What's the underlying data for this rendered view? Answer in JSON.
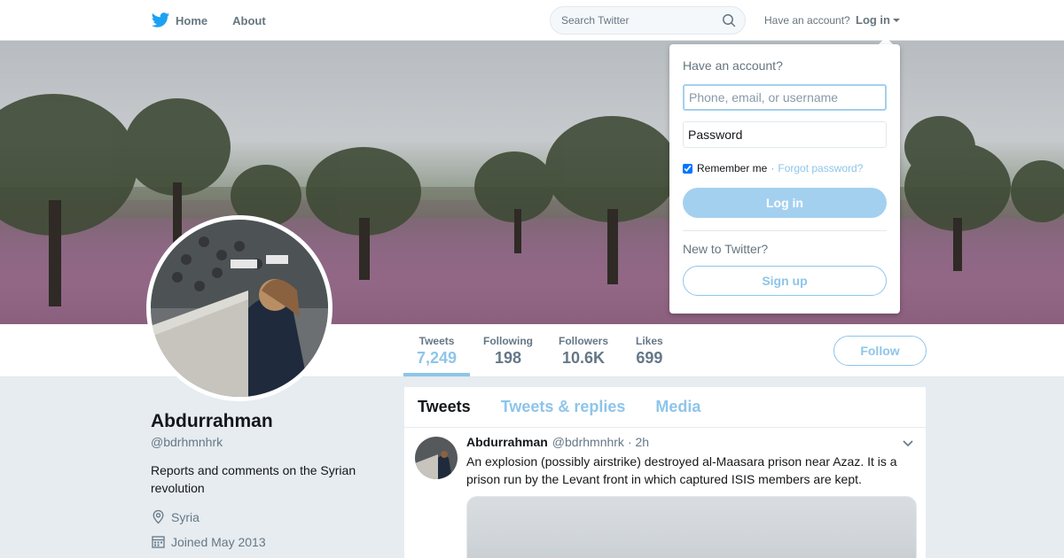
{
  "nav": {
    "home_label": "Home",
    "about_label": "About",
    "search_placeholder": "Search Twitter",
    "have_account": "Have an account?",
    "login_label": "Log in"
  },
  "profile": {
    "name": "Abdurrahman",
    "handle": "@bdrhmnhrk",
    "bio": "Reports and comments on the Syrian revolution",
    "location": "Syria",
    "joined": "Joined May 2013"
  },
  "stats": [
    {
      "label": "Tweets",
      "value": "7,249",
      "active": true
    },
    {
      "label": "Following",
      "value": "198"
    },
    {
      "label": "Followers",
      "value": "10.6K"
    },
    {
      "label": "Likes",
      "value": "699"
    }
  ],
  "follow_label": "Follow",
  "timeline": {
    "tabs": [
      "Tweets",
      "Tweets & replies",
      "Media"
    ],
    "tweet": {
      "name": "Abdurrahman",
      "handle": "@bdrhmnhrk",
      "time": "· 2h",
      "text": "An explosion (possibly airstrike) destroyed al-Maasara prison near Azaz. It is a prison run by the Levant front in which captured ISIS members are kept."
    }
  },
  "login_dropdown": {
    "title": "Have an account?",
    "username_placeholder": "Phone, email, or username",
    "password_placeholder": "Password",
    "remember_label": "Remember me",
    "remember_checked": true,
    "forgot_label": "Forgot password?",
    "login_button": "Log in",
    "new_label": "New to Twitter?",
    "signup_button": "Sign up"
  },
  "colors": {
    "accent": "#1da1f2",
    "light_accent": "#8ec5ea",
    "text_muted": "#657786"
  }
}
